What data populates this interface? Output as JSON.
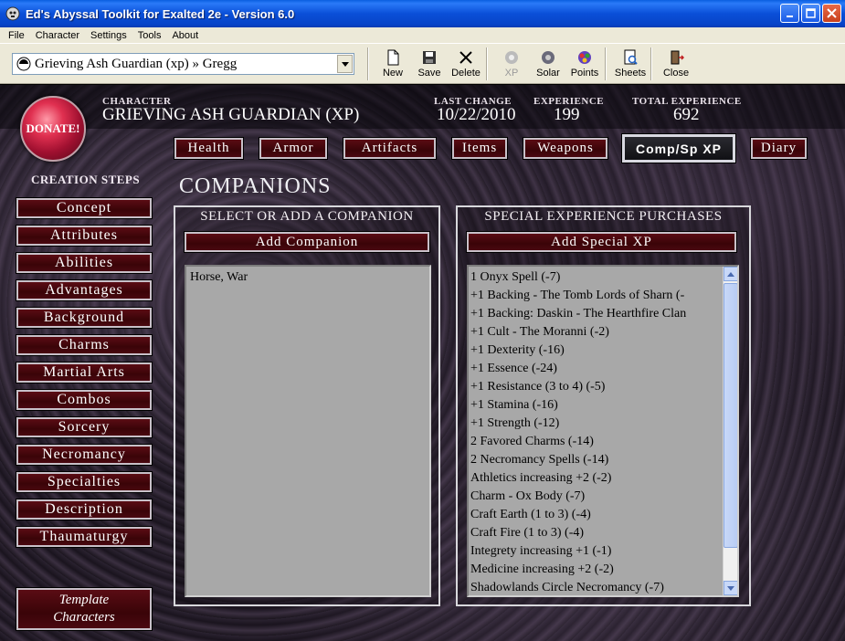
{
  "window": {
    "title": "Ed's Abyssal Toolkit for Exalted 2e - Version 6.0"
  },
  "menu": [
    "File",
    "Character",
    "Settings",
    "Tools",
    "About"
  ],
  "character_select": {
    "value": "Grieving Ash Guardian (xp) » Gregg"
  },
  "toolbar": {
    "new": "New",
    "save": "Save",
    "delete": "Delete",
    "xp": "XP",
    "solar": "Solar",
    "points": "Points",
    "sheets": "Sheets",
    "close": "Close"
  },
  "donate": "DONATE!",
  "header": {
    "character_label": "CHARACTER",
    "character_value": "GRIEVING ASH GUARDIAN (XP)",
    "last_change_label": "LAST CHANGE",
    "last_change_value": "10/22/2010",
    "experience_label": "EXPERIENCE",
    "experience_value": "199",
    "total_label": "TOTAL EXPERIENCE",
    "total_value": "692"
  },
  "tabs": [
    {
      "label": "Health"
    },
    {
      "label": "Armor"
    },
    {
      "label": "Artifacts"
    },
    {
      "label": "Items"
    },
    {
      "label": "Weapons"
    },
    {
      "label": "Comp/Sp XP"
    },
    {
      "label": "Diary"
    }
  ],
  "creation": {
    "title": "CREATION STEPS",
    "steps": [
      "Concept",
      "Attributes",
      "Abilities",
      "Advantages",
      "Background",
      "Charms",
      "Martial Arts",
      "Combos",
      "Sorcery",
      "Necromancy",
      "Specialties",
      "Description",
      "Thaumaturgy"
    ],
    "template_line1": "Template",
    "template_line2": "Characters"
  },
  "section_title": "COMPANIONS",
  "companions": {
    "title": "SELECT OR ADD A COMPANION",
    "add_button": "Add Companion",
    "items": [
      "Horse, War"
    ]
  },
  "special_xp": {
    "title": "SPECIAL EXPERIENCE PURCHASES",
    "add_button": "Add Special XP",
    "items": [
      "1 Onyx Spell  (-7)",
      "+1 Backing - The Tomb Lords of Sharn  (-",
      "+1 Backing: Daskin - The Hearthfire Clan",
      "+1 Cult - The Moranni  (-2)",
      "+1 Dexterity  (-16)",
      "+1 Essence  (-24)",
      "+1 Resistance (3 to 4)  (-5)",
      "+1 Stamina  (-16)",
      "+1 Strength  (-12)",
      "2 Favored Charms  (-14)",
      "2 Necromancy Spells  (-14)",
      "Athletics increasing +2  (-2)",
      "Charm - Ox Body  (-7)",
      "Craft Earth (1 to 3)  (-4)",
      "Craft Fire (1 to 3)  (-4)",
      "Integrety increasing +1  (-1)",
      "Medicine increasing +2  (-2)",
      "Shadowlands Circle Necromancy  (-7)"
    ]
  }
}
